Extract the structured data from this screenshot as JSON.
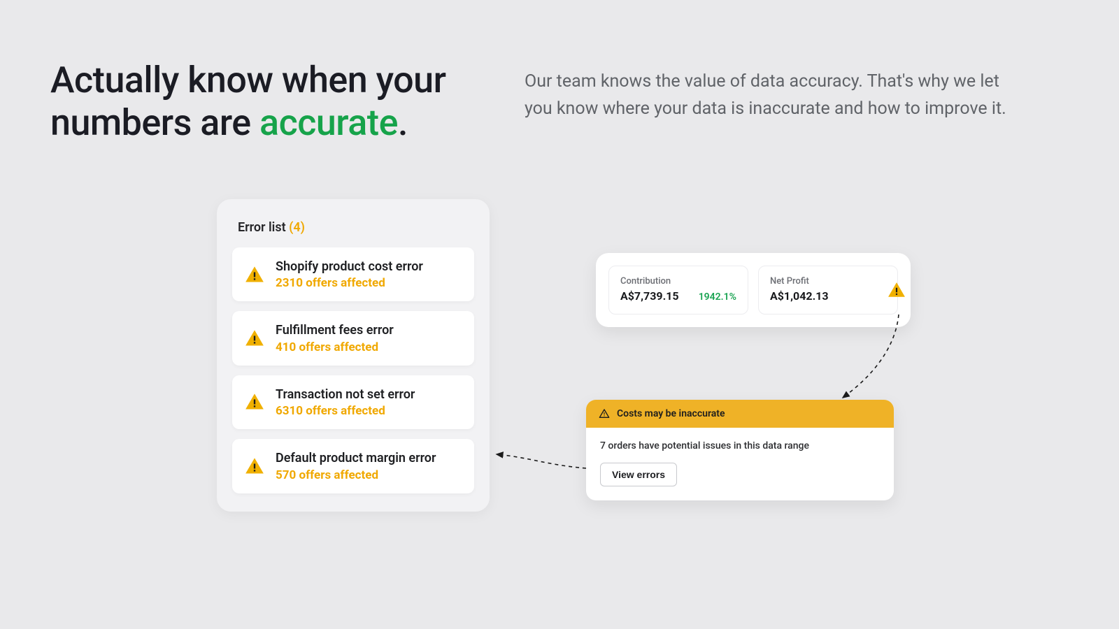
{
  "headline": {
    "before": "Actually know when your numbers are ",
    "highlight": "accurate",
    "after": "."
  },
  "subcopy": "Our team knows the value of data accuracy. That's why we let you know where your data is inaccurate and how to improve it.",
  "error_list": {
    "title": "Error list",
    "count": "(4)",
    "items": [
      {
        "title": "Shopify product cost error",
        "sub": "2310 offers affected"
      },
      {
        "title": "Fulfillment fees error",
        "sub": "410 offers affected"
      },
      {
        "title": "Transaction not set error",
        "sub": "6310 offers affected"
      },
      {
        "title": "Default product margin error",
        "sub": "570 offers affected"
      }
    ]
  },
  "stats": {
    "contribution_label": "Contribution",
    "contribution_value": "A$7,739.15",
    "contribution_pct": "1942.1%",
    "net_profit_label": "Net Profit",
    "net_profit_value": "A$1,042.13"
  },
  "notice": {
    "header": "Costs may be inaccurate",
    "body": "7 orders have potential issues in this data range",
    "button": "View errors"
  }
}
